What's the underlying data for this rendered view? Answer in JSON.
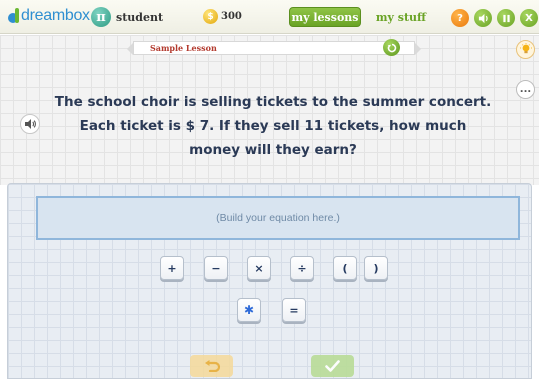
{
  "header": {
    "logo_text": "dreambox",
    "student_symbol": "π",
    "student_label": "student",
    "coins": "300",
    "tab_lessons": "my lessons",
    "tab_stuff": "my stuff",
    "help_glyph": "?",
    "close_glyph": "X"
  },
  "lesson": {
    "title": "Sample Lesson",
    "more_glyph": "..."
  },
  "question": {
    "line1": "The school choir is selling tickets to the summer concert.",
    "line2": "Each ticket is $ 7. If they sell 11 tickets, how much",
    "line3": "money will they earn?"
  },
  "workspace": {
    "equation_placeholder": "(Build your equation here.)",
    "keys_row1": [
      "+",
      "−",
      "×",
      "÷",
      "(",
      ")"
    ],
    "keys_row2": [
      "✱",
      "="
    ]
  },
  "icons": {
    "hint": "lightbulb-icon",
    "audio": "speaker-icon",
    "undo": "undo-icon",
    "check": "check-icon"
  },
  "colors": {
    "brand_green": "#6aa326",
    "brand_blue": "#2f8fd1",
    "question_text": "#2b3a56",
    "help_orange": "#ea7a0d"
  }
}
